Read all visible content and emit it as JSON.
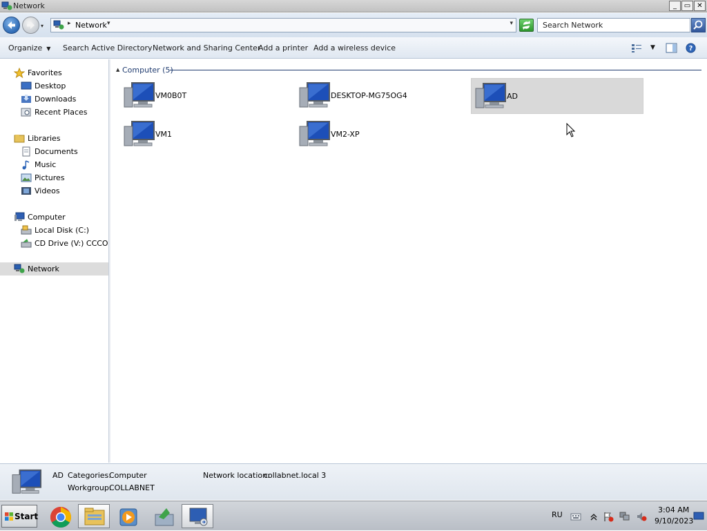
{
  "window": {
    "title": "Network",
    "controls": {
      "minimize": "_",
      "maximize": "▭",
      "close": "✕"
    }
  },
  "address": {
    "path": "Network",
    "search_placeholder": "Search Network"
  },
  "toolbar": {
    "organize": "Organize",
    "search_ad": "Search Active Directory",
    "network_center": "Network and Sharing Center",
    "add_printer": "Add a printer",
    "add_wireless": "Add a wireless device"
  },
  "nav": {
    "favorites": "Favorites",
    "desktop": "Desktop",
    "downloads": "Downloads",
    "recent": "Recent Places",
    "libraries": "Libraries",
    "documents": "Documents",
    "music": "Music",
    "pictures": "Pictures",
    "videos": "Videos",
    "computer": "Computer",
    "local_disk": "Local Disk (C:)",
    "cd_drive": "CD Drive (V:) CCCOMA",
    "network": "Network"
  },
  "content": {
    "group_label": "Computer (5)",
    "items": [
      "VM0B0T",
      "DESKTOP-MG75OG4",
      "AD",
      "VM1",
      "VM2-XP"
    ],
    "selected": "AD"
  },
  "details": {
    "name": "AD",
    "categories_label": "Categories:",
    "categories_value": "Computer",
    "workgroup_label": "Workgroup:",
    "workgroup_value": "COLLABNET",
    "location_label": "Network location:",
    "location_value": "collabnet.local  3"
  },
  "taskbar": {
    "start": "Start",
    "language": "RU",
    "time": "3:04 AM",
    "date": "9/10/2023"
  },
  "colors": {
    "accent": "#1e3a6e",
    "selection": "#d9d9d9"
  }
}
